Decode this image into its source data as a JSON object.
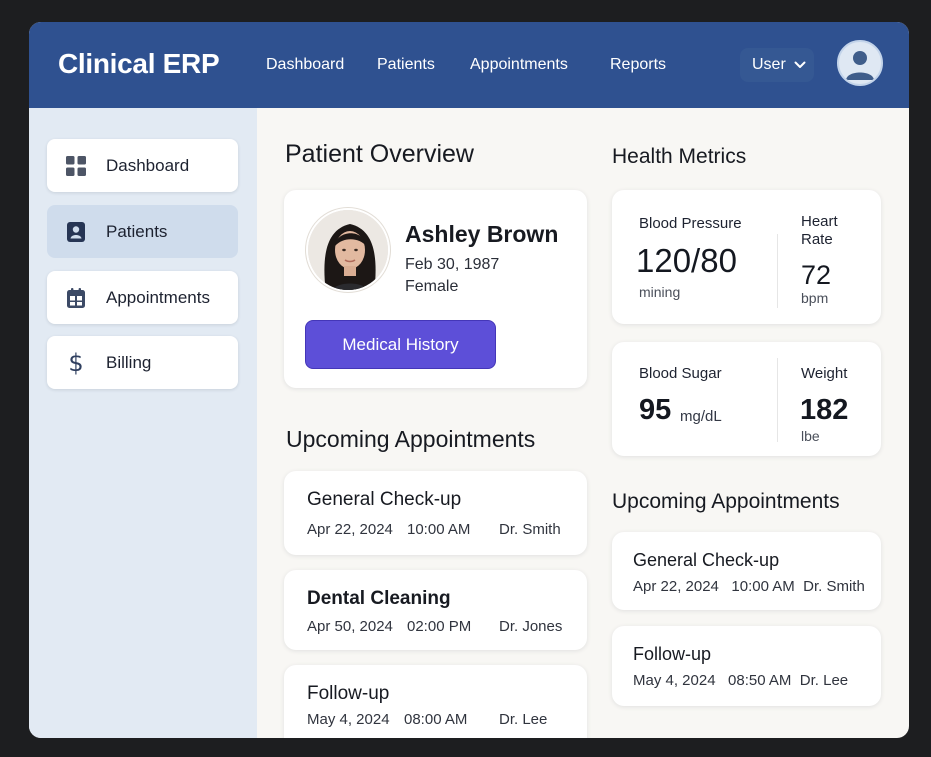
{
  "app": {
    "title": "Clinical ERP"
  },
  "nav": {
    "items": [
      "Dashboard",
      "Patients",
      "Appointments",
      "Reports"
    ]
  },
  "user": {
    "label": "User"
  },
  "sidebar": {
    "items": [
      {
        "label": "Dashboard",
        "icon": "grid-icon"
      },
      {
        "label": "Patients",
        "icon": "patient-id-icon",
        "active": true
      },
      {
        "label": "Appointments",
        "icon": "calendar-icon"
      },
      {
        "label": "Billing",
        "icon": "dollar-icon"
      }
    ]
  },
  "overview": {
    "title": "Patient Overview",
    "patient": {
      "name": "Ashley Brown",
      "dob": "Feb 30, 1987",
      "gender": "Female"
    },
    "history_button": "Medical History"
  },
  "appointments_main": {
    "title": "Upcoming Appointments",
    "items": [
      {
        "title": "General Check-up",
        "date": "Apr 22, 2024",
        "time": "10:00 AM",
        "doctor": "Dr. Smith"
      },
      {
        "title": "Dental Cleaning",
        "date": "Apr 50, 2024",
        "time": "02:00 PM",
        "doctor": "Dr. Jones"
      },
      {
        "title": "Follow-up",
        "date": "May 4, 2024",
        "time": "08:00 AM",
        "doctor": "Dr. Lee"
      }
    ]
  },
  "metrics": {
    "title": "Health Metrics",
    "blood_pressure": {
      "label": "Blood Pressure",
      "value": "120/80",
      "unit": "mining"
    },
    "heart_rate": {
      "label": "Heart Rate",
      "value": "72",
      "unit": "bpm"
    },
    "blood_sugar": {
      "label": "Blood Sugar",
      "value": "95",
      "unit": "mg/dL"
    },
    "weight": {
      "label": "Weight",
      "value": "182",
      "unit": "lbe"
    }
  },
  "appointments_side": {
    "title": "Upcoming Appointments",
    "items": [
      {
        "title": "General Check-up",
        "meta": "Apr 22, 2024   10:00 AM  Dr. Smith"
      },
      {
        "title": "Follow-up",
        "meta": "May 4, 2024   08:50 AM  Dr. Lee"
      }
    ]
  },
  "colors": {
    "header": "#2f5190",
    "accent": "#5d4fd8",
    "sidebar": "#e2eaf3",
    "sidebar_active": "#cfdcec"
  }
}
